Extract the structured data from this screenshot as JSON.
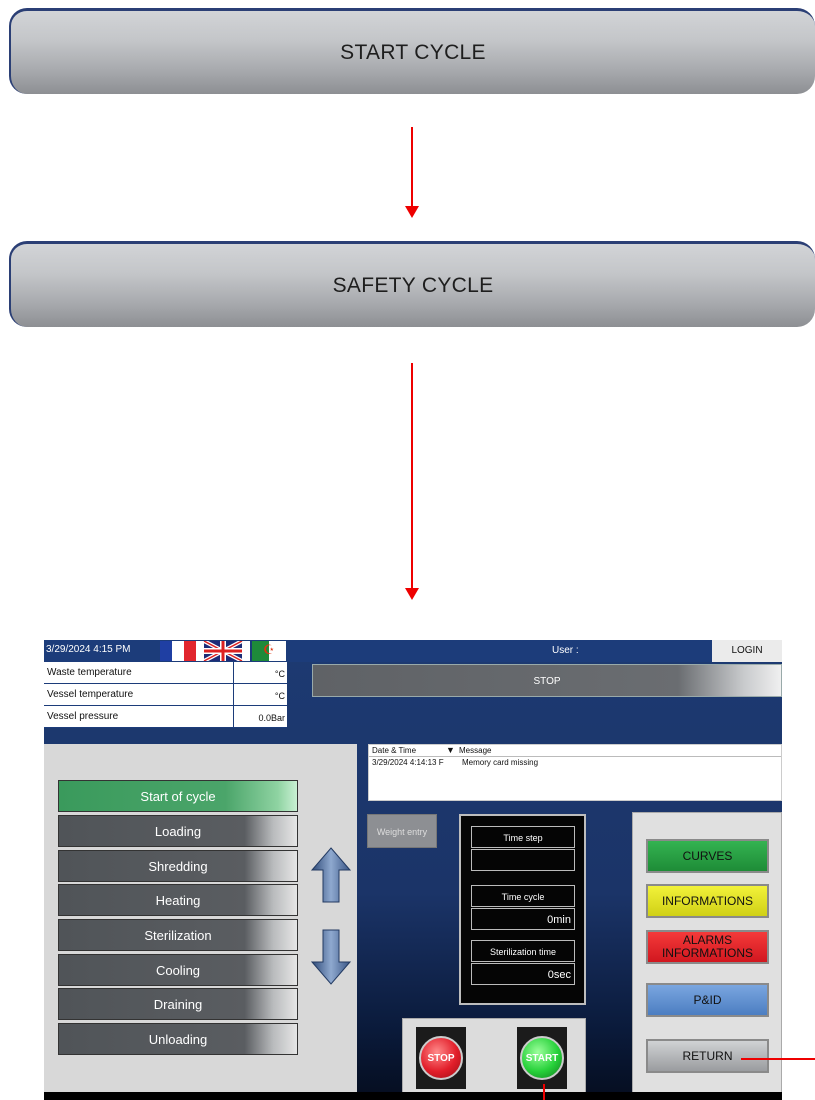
{
  "flow": {
    "start_cycle_label": "START CYCLE",
    "safety_cycle_label": "SAFETY CYCLE"
  },
  "hmi": {
    "datetime": "3/29/2024 4:15 PM",
    "user_label": "User :",
    "login_label": "LOGIN",
    "status": "STOP",
    "sensors": [
      {
        "label": "Waste temperature",
        "value": "°C"
      },
      {
        "label": "Vessel temperature",
        "value": "°C"
      },
      {
        "label": "Vessel pressure",
        "value": "0.0Bar"
      }
    ],
    "steps": [
      {
        "label": "Start of cycle",
        "active": true
      },
      {
        "label": "Loading"
      },
      {
        "label": "Shredding"
      },
      {
        "label": "Heating"
      },
      {
        "label": "Sterilization"
      },
      {
        "label": "Cooling"
      },
      {
        "label": "Draining"
      },
      {
        "label": "Unloading"
      }
    ],
    "alarm_table": {
      "col_datetime": "Date & Time",
      "sort_glyph": "▼",
      "col_message": "Message",
      "rows": [
        {
          "datetime": "3/29/2024 4:14:13 F",
          "message": "Memory card missing"
        }
      ]
    },
    "weight_entry_label": "Weight entry",
    "time_step_label": "Time step",
    "time_step_value": "",
    "time_cycle_label": "Time cycle",
    "time_cycle_value": "0min",
    "steril_time_label": "Sterilization time",
    "steril_time_value": "0sec",
    "stop_button": "STOP",
    "start_button": "START",
    "menu": {
      "curves": "CURVES",
      "informations": "INFORMATIONS",
      "alarms_line1": "ALARMS",
      "alarms_line2": "INFORMATIONS",
      "pid": "P&ID",
      "return": "RETURN"
    },
    "colors": {
      "curves": "#1e9a3c",
      "informations": "#e3e31e",
      "alarms": "#e8202a",
      "pid": "#5b8fd2",
      "return": "#b0b2b4"
    }
  }
}
